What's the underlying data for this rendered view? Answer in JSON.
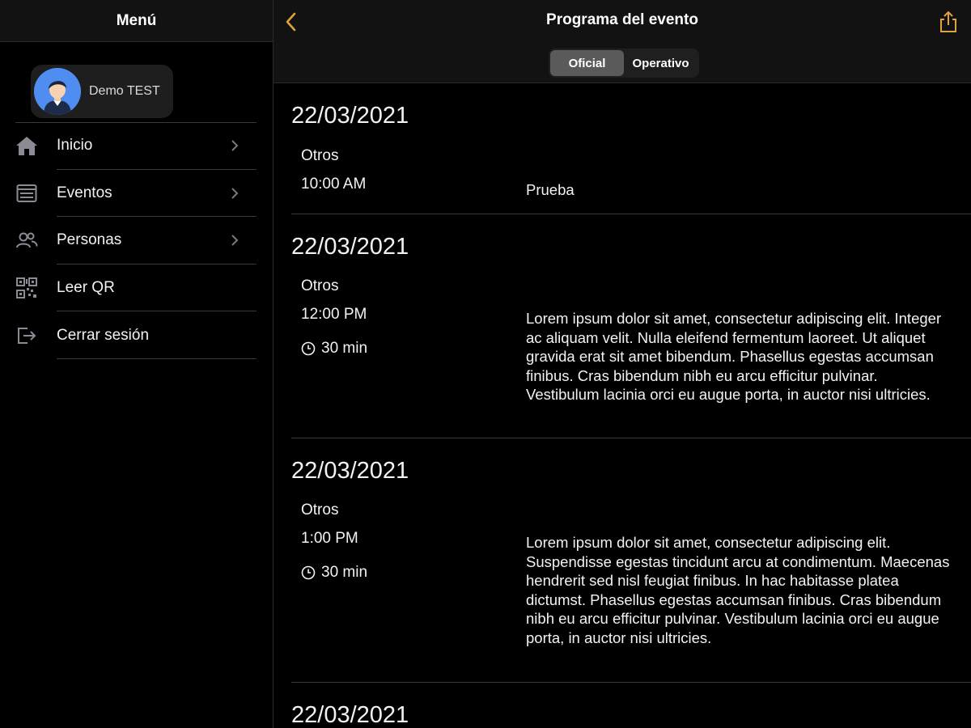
{
  "sidebar": {
    "title": "Menú",
    "profile": {
      "name": "Demo TEST",
      "avatar_color": "#4f8ef0"
    },
    "items": [
      {
        "label": "Inicio",
        "icon": "home-icon",
        "has_chevron": true
      },
      {
        "label": "Eventos",
        "icon": "calendar-list-icon",
        "has_chevron": true
      },
      {
        "label": "Personas",
        "icon": "people-icon",
        "has_chevron": true
      },
      {
        "label": "Leer QR",
        "icon": "qr-code-icon",
        "has_chevron": false
      },
      {
        "label": "Cerrar sesión",
        "icon": "logout-icon",
        "has_chevron": false
      }
    ]
  },
  "main": {
    "title": "Programa del evento",
    "accent_color": "#e0a23a",
    "segments": [
      {
        "label": "Oficial",
        "active": true
      },
      {
        "label": "Operativo",
        "active": false
      }
    ],
    "entries": [
      {
        "date": "22/03/2021",
        "category": "Otros",
        "time": "10:00 AM",
        "duration": "",
        "description": "Prueba"
      },
      {
        "date": "22/03/2021",
        "category": "Otros",
        "time": "12:00 PM",
        "duration": "30 min",
        "description": "Lorem ipsum dolor sit amet, consectetur adipiscing elit. Integer ac aliquam velit. Nulla eleifend fermentum laoreet. Ut aliquet gravida erat sit amet bibendum. Phasellus egestas accumsan finibus. Cras bibendum nibh eu arcu efficitur pulvinar. Vestibulum lacinia orci eu augue porta, in auctor nisi ultricies."
      },
      {
        "date": "22/03/2021",
        "category": "Otros",
        "time": "1:00 PM",
        "duration": "30 min",
        "description": "Lorem ipsum dolor sit amet, consectetur adipiscing elit. Suspendisse egestas tincidunt arcu at condimentum. Maecenas hendrerit sed nisl feugiat finibus. In hac habitasse platea dictumst. Phasellus egestas accumsan finibus. Cras bibendum nibh eu arcu efficitur pulvinar. Vestibulum lacinia orci eu augue porta, in auctor nisi ultricies."
      },
      {
        "date": "22/03/2021",
        "category": "",
        "time": "",
        "duration": "",
        "description": ""
      }
    ]
  }
}
